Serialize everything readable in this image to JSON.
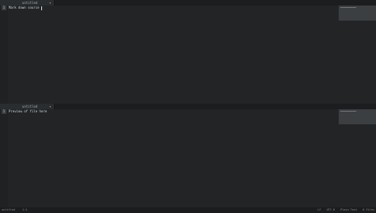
{
  "top_pane": {
    "tab": {
      "label": "untitled",
      "dropdown_icon": "▾"
    },
    "line_number": "1",
    "code_text": "Mark down source"
  },
  "bottom_pane": {
    "tab": {
      "label": "untitled",
      "dropdown_icon": "▾"
    },
    "line_number": "1",
    "code_text": "Preview of file here"
  },
  "status": {
    "file_name": "untitled",
    "position": "1:1",
    "spaces": "LF",
    "encoding": "UTF-8",
    "syntax": "Plain Text",
    "notifications": "0 Files"
  },
  "theme": {
    "background": "#222426",
    "gutter": "#1f2123",
    "tab_bar": "#1b1d1e",
    "tab": "#2a2d30",
    "minimap": "#3c3f42",
    "status_bar": "#1a1c1d",
    "text": "#d6d9db"
  }
}
